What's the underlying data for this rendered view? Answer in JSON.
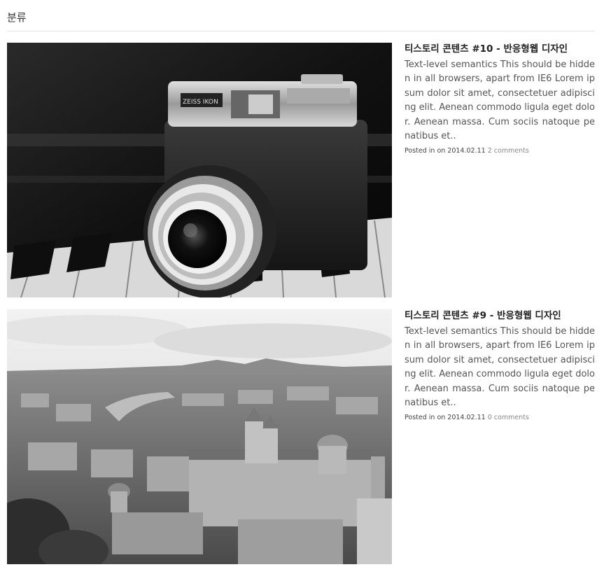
{
  "category": {
    "title": "분류"
  },
  "posts": [
    {
      "title": "티스토리 콘텐츠 #10 - 반응형웹 디자인",
      "excerpt": "Text-level semantics This should be hidden in all browsers, apart from IE6 Lorem ipsum dolor sit amet, consectetuer adipiscing elit. Aenean commodo ligula eget dolor. Aenean massa. Cum sociis natoque penatibus et..",
      "meta_prefix": "Posted in on 2014.02.11",
      "comments": "2 comments",
      "image_subject": "camera on piano keys",
      "image_lettering": "ZEISS IKON"
    },
    {
      "title": "티스토리 콘텐츠 #9 - 반응형웹 디자인",
      "excerpt": "Text-level semantics This should be hidden in all browsers, apart from IE6 Lorem ipsum dolor sit amet, consectetuer adipiscing elit. Aenean commodo ligula eget dolor. Aenean massa. Cum sociis natoque penatibus et..",
      "meta_prefix": "Posted in on 2014.02.11",
      "comments": "0 comments",
      "image_subject": "aerial city view with cathedral domes"
    }
  ]
}
